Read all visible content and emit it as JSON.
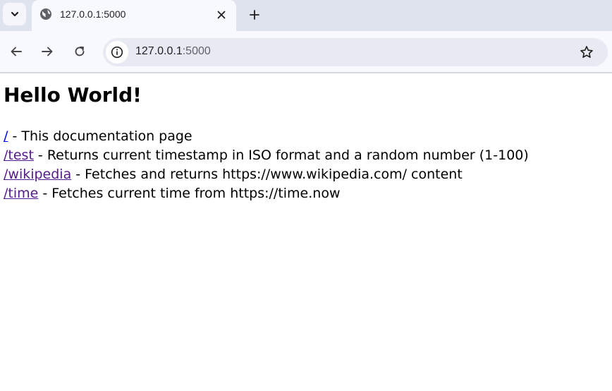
{
  "browser": {
    "tab": {
      "title": "127.0.0.1:5000"
    },
    "address": {
      "host": "127.0.0.1",
      "port": ":5000"
    }
  },
  "page": {
    "heading": "Hello World!",
    "routes": [
      {
        "link": "/",
        "description": " - This documentation page",
        "visited": false
      },
      {
        "link": "/test",
        "description": " - Returns current timestamp in ISO format and a random number (1-100)",
        "visited": true
      },
      {
        "link": "/wikipedia",
        "description": " - Fetches and returns https://www.wikipedia.com/ content",
        "visited": true
      },
      {
        "link": "/time",
        "description": " - Fetches current time from https://time.now",
        "visited": true
      }
    ]
  },
  "colors": {
    "link_unvisited": "#0000ee",
    "link_visited": "#551a8b",
    "tabstrip": "#dee3ee",
    "toolbar": "#f8f9fe"
  },
  "icons": [
    "chevron-down-icon",
    "globe-icon",
    "close-icon",
    "plus-icon",
    "back-arrow-icon",
    "forward-arrow-icon",
    "reload-icon",
    "info-icon",
    "star-icon"
  ]
}
